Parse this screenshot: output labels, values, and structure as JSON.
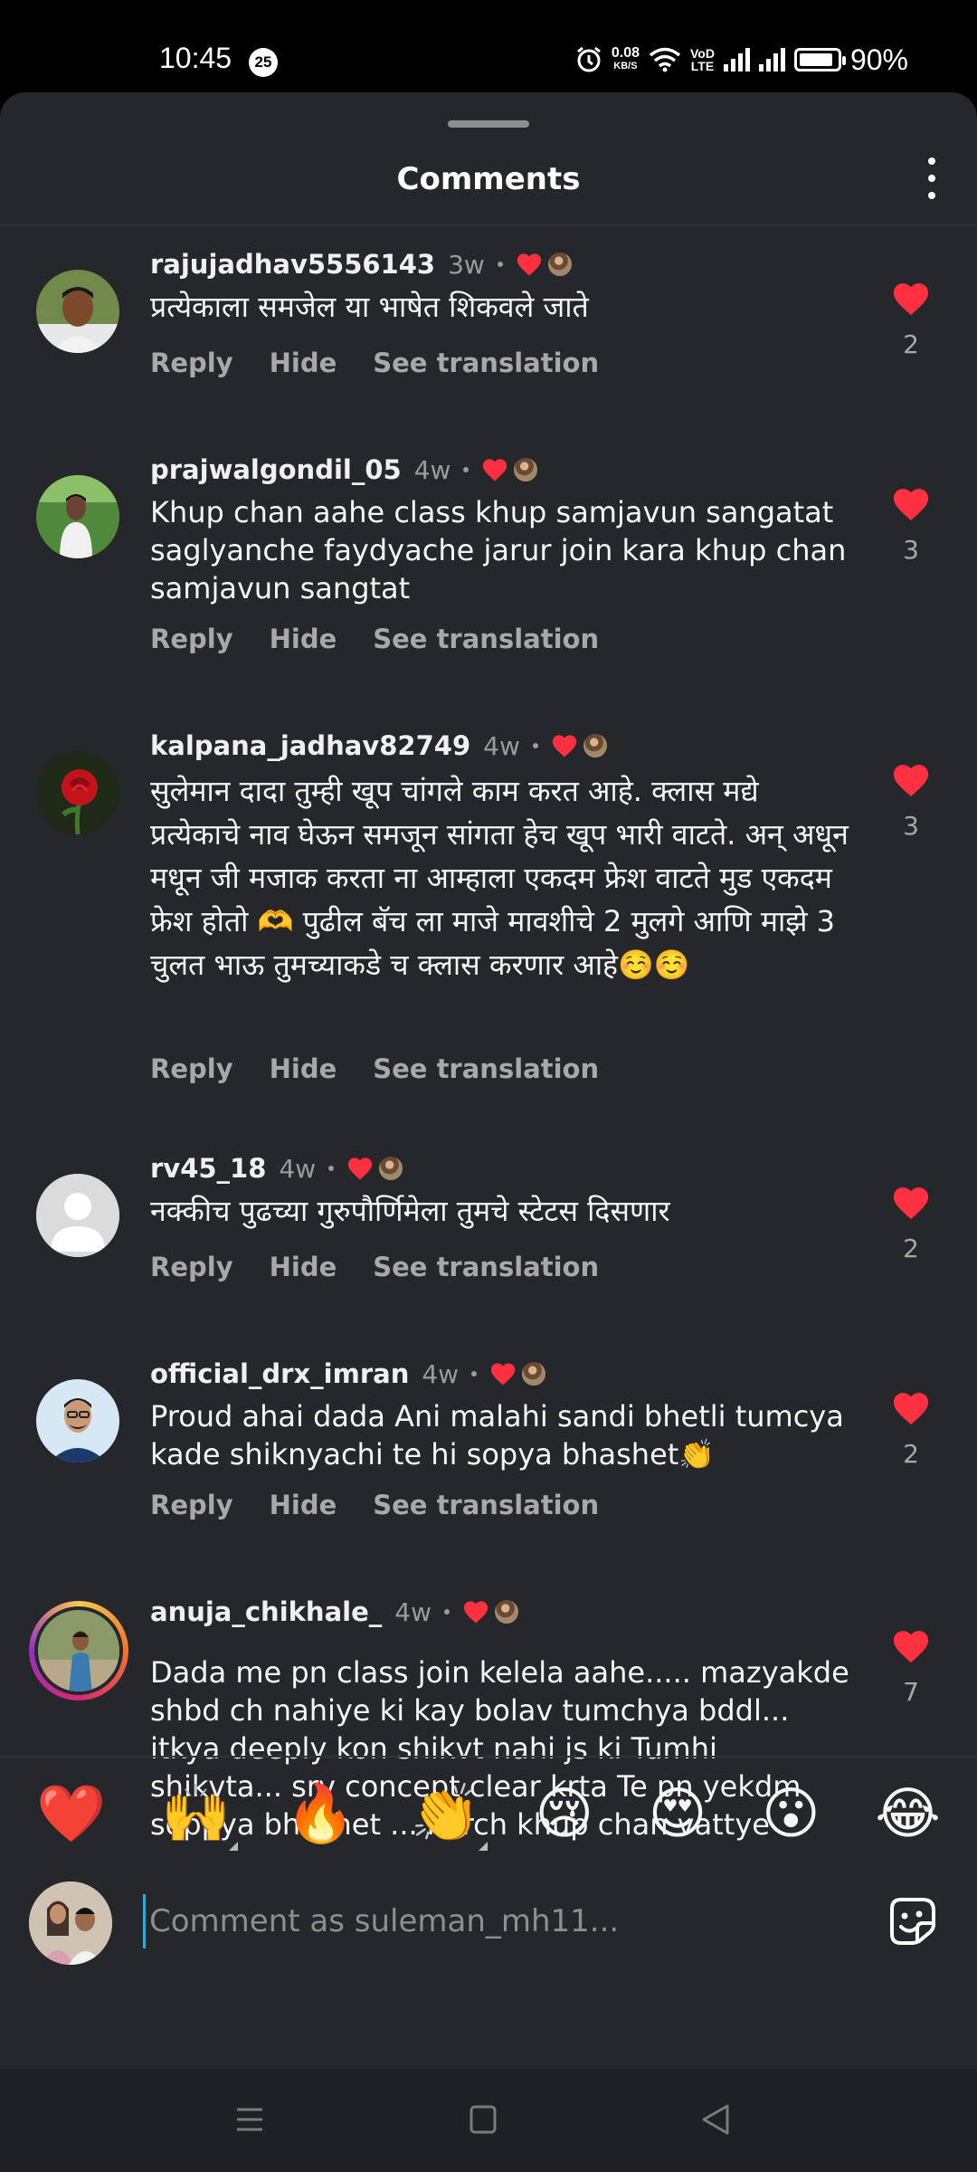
{
  "status": {
    "time": "10:45",
    "badge": "25",
    "speed_value": "0.08",
    "speed_unit": "KB/S",
    "volte_top": "VoD",
    "volte_bottom": "LTE",
    "battery_pct": "90%",
    "battery_level": 0.9
  },
  "header": {
    "title": "Comments"
  },
  "actions": {
    "reply": "Reply",
    "hide": "Hide",
    "translate": "See translation"
  },
  "comments": [
    {
      "username": "rajujadhav5556143",
      "time": "3w",
      "text": "प्रत्येकाला समजेल या भाषेत शिकवले जाते",
      "likes": "2"
    },
    {
      "username": "prajwalgondil_05",
      "time": "4w",
      "text": "Khup chan aahe class khup samjavun sangatat saglyanche faydyache jarur join kara khup chan samjavun sangtat",
      "likes": "3"
    },
    {
      "username": "kalpana_jadhav82749",
      "time": "4w",
      "text": "सुलेमान दादा तुम्ही खूप चांगले काम करत आहे. क्लास मद्ये प्रत्येकाचे नाव घेऊन समजून सांगता हेच खूप भारी वाटते. अन् अधून मधून जी मजाक करता ना आम्हाला एकदम फ्रेश वाटते मुड एकदम फ्रेश होतो 🫶 पुढील बॅच ला माजे मावशीचे 2 मुलगे आणि माझे 3 चुलत भाऊ तुमच्याकडे च क्लास करणार आहे☺️☺️",
      "likes": "3"
    },
    {
      "username": "rv45_18",
      "time": "4w",
      "text": "नक्कीच पुढच्या गुरुपौर्णिमेला तुमचे स्टेटस दिसणार",
      "likes": "2"
    },
    {
      "username": "official_drx_imran",
      "time": "4w",
      "text": "Proud ahai dada Ani malahi sandi bhetli tumcya kade shiknyachi te hi sopya bhashet👏",
      "likes": "2"
    },
    {
      "username": "anuja_chikhale_",
      "time": "4w",
      "text": "Dada me pn class join kelela aahe..... mazyakde shbd ch nahiye ki kay bolav tumchya bddl... itkya deeply kon shikvt nahi js ki Tumhi shikvta... srv concept clear krta Te pn yekdm soppya bhashet ... khrch khup chan vattye tumchya kde",
      "likes": "7"
    }
  ],
  "emojis": [
    "❤️",
    "🙌",
    "🔥",
    "👏",
    "😢",
    "😍",
    "😮",
    "😂"
  ],
  "composer": {
    "placeholder": "Comment as suleman_mh11..."
  },
  "colors": {
    "sheet_bg": "#25272b",
    "like_red": "#ff3040",
    "muted_text": "#a8a8a8"
  }
}
